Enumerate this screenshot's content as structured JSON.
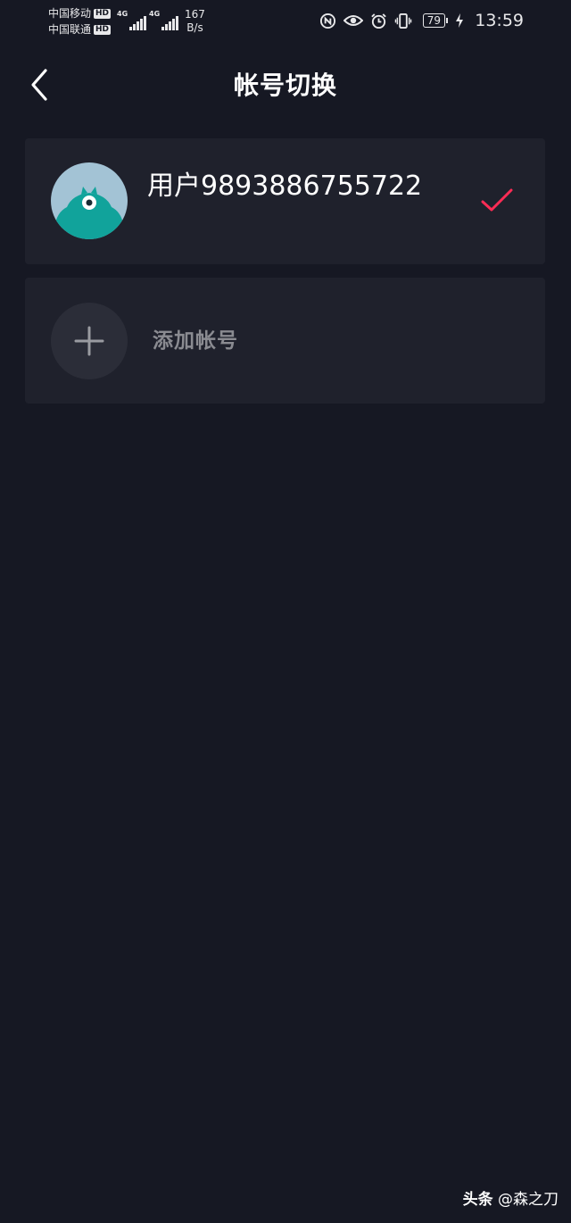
{
  "status_bar": {
    "carrier_1": "中国移动",
    "carrier_2": "中国联通",
    "hd_badge": "HD",
    "network_type": "4G",
    "speed_value": "167",
    "speed_unit": "B/s",
    "battery_level": "79",
    "time": "13:59"
  },
  "header": {
    "title": "帐号切换",
    "back_icon": "chevron-left-icon"
  },
  "accounts": [
    {
      "username": "用户9893886755722",
      "selected": true,
      "check_icon": "checkmark-icon"
    }
  ],
  "add_account": {
    "label": "添加帐号",
    "icon": "plus-icon"
  },
  "watermark": {
    "brand": "头条",
    "handle": "@森之刀"
  },
  "colors": {
    "background": "#161823",
    "card": "#1f212c",
    "check_accent": "#fe2c55",
    "avatar_teal": "#11a39b",
    "avatar_sky": "#a3c3d5"
  }
}
